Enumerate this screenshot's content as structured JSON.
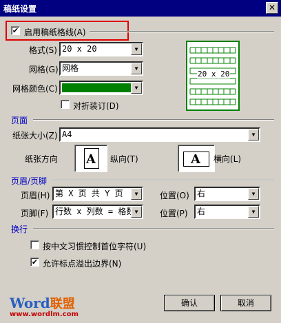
{
  "window": {
    "title": "稿纸设置",
    "close_glyph": "✕"
  },
  "enable": {
    "label": "启用稿纸格线(A)",
    "checked": "✔"
  },
  "format": {
    "style_label": "格式(S)",
    "style_value": "20 x 20",
    "grid_label": "网格(G)",
    "grid_value": "网格",
    "color_label": "网格颜色(C)",
    "color_value": "#008000",
    "fold_label": "对折装订(D)",
    "fold_checked": ""
  },
  "preview": {
    "text": "20 x 20",
    "color": "#008000"
  },
  "page": {
    "section_label": "页面",
    "size_label": "纸张大小(Z)",
    "size_value": "A4",
    "orientation_label": "纸张方向",
    "portrait_label": "纵向(T)",
    "landscape_label": "横向(L)",
    "icon_letter": "A"
  },
  "header_footer": {
    "section_label": "页眉/页脚",
    "header_label": "页眉(H)",
    "header_value": "第 X 页 共 Y 页",
    "header_pos_label": "位置(O)",
    "header_pos_value": "右",
    "footer_label": "页脚(F)",
    "footer_value": "行数 x 列数 = 格数",
    "footer_pos_label": "位置(P)",
    "footer_pos_value": "右"
  },
  "line_break": {
    "section_label": "换行",
    "option1_label": "按中文习惯控制首位字符(U)",
    "option1_checked": "",
    "option2_label": "允许标点溢出边界(N)",
    "option2_checked": "✔"
  },
  "buttons": {
    "ok": "确认",
    "cancel": "取消"
  },
  "watermark": {
    "word": "Word",
    "lianmeng": "联盟",
    "url": "www.wordlm.com"
  },
  "colors": {
    "title_bar": "#000080",
    "section_text": "#0000c0",
    "highlight_box": "#e00000",
    "grid_green": "#008000"
  }
}
